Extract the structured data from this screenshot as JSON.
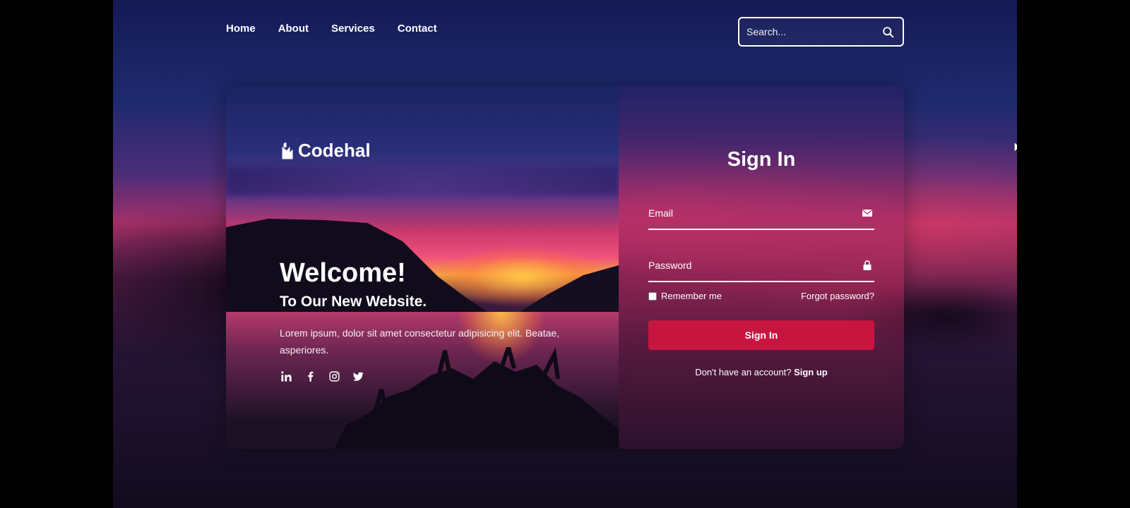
{
  "nav": {
    "items": [
      {
        "label": "Home"
      },
      {
        "label": "About"
      },
      {
        "label": "Services"
      },
      {
        "label": "Contact"
      }
    ],
    "search": {
      "placeholder": "Search...",
      "icon": "search-icon"
    }
  },
  "brand": {
    "name": "Codehal",
    "icon": "bag-logo-icon"
  },
  "hero": {
    "title": "Welcome!",
    "subtitle": "To Our New Website.",
    "description": "Lorem ipsum, dolor sit amet consectetur adipisicing elit. Beatae, asperiores.",
    "socials": [
      {
        "icon": "linkedin-icon"
      },
      {
        "icon": "facebook-icon"
      },
      {
        "icon": "instagram-icon"
      },
      {
        "icon": "twitter-icon"
      }
    ]
  },
  "signin": {
    "title": "Sign In",
    "email_placeholder": "Email",
    "email_icon": "mail-icon",
    "password_placeholder": "Password",
    "password_icon": "lock-icon",
    "remember_label": "Remember me",
    "remember_checked": false,
    "forgot_label": "Forgot password?",
    "button_label": "Sign In",
    "signup_prompt": "Don't have an account?",
    "signup_link": "Sign up"
  },
  "colors": {
    "accent": "#c8153f",
    "text": "#ffffff",
    "sky_top": "#1b2362",
    "sunset": "#f0507c"
  }
}
